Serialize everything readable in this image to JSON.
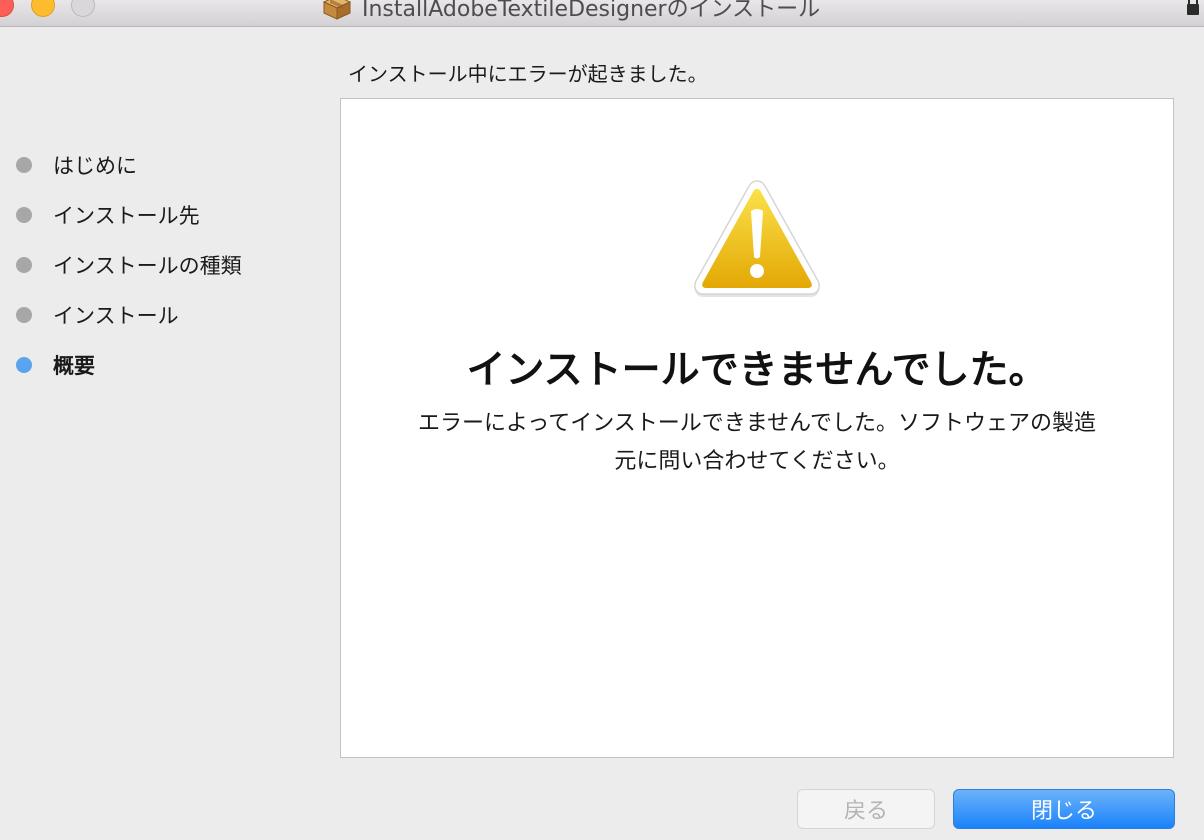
{
  "window": {
    "title": "InstallAdobeTextileDesignerのインストール"
  },
  "heading": "インストール中にエラーが起きました。",
  "sidebar": {
    "steps": [
      {
        "label": "はじめに",
        "state": "done"
      },
      {
        "label": "インストール先",
        "state": "done"
      },
      {
        "label": "インストールの種類",
        "state": "done"
      },
      {
        "label": "インストール",
        "state": "done"
      },
      {
        "label": "概要",
        "state": "current"
      }
    ]
  },
  "content": {
    "icon": "warning-icon",
    "title": "インストールできませんでした。",
    "message": "エラーによってインストールできませんでした。ソフトウェアの製造元に問い合わせてください。"
  },
  "buttons": {
    "back_label": "戻る",
    "close_label": "閉じる"
  },
  "colors": {
    "accent": "#1a82fb",
    "active_step": "#5aa3ee",
    "inactive_step": "#a7a7a7",
    "warning": "#f2c318"
  }
}
